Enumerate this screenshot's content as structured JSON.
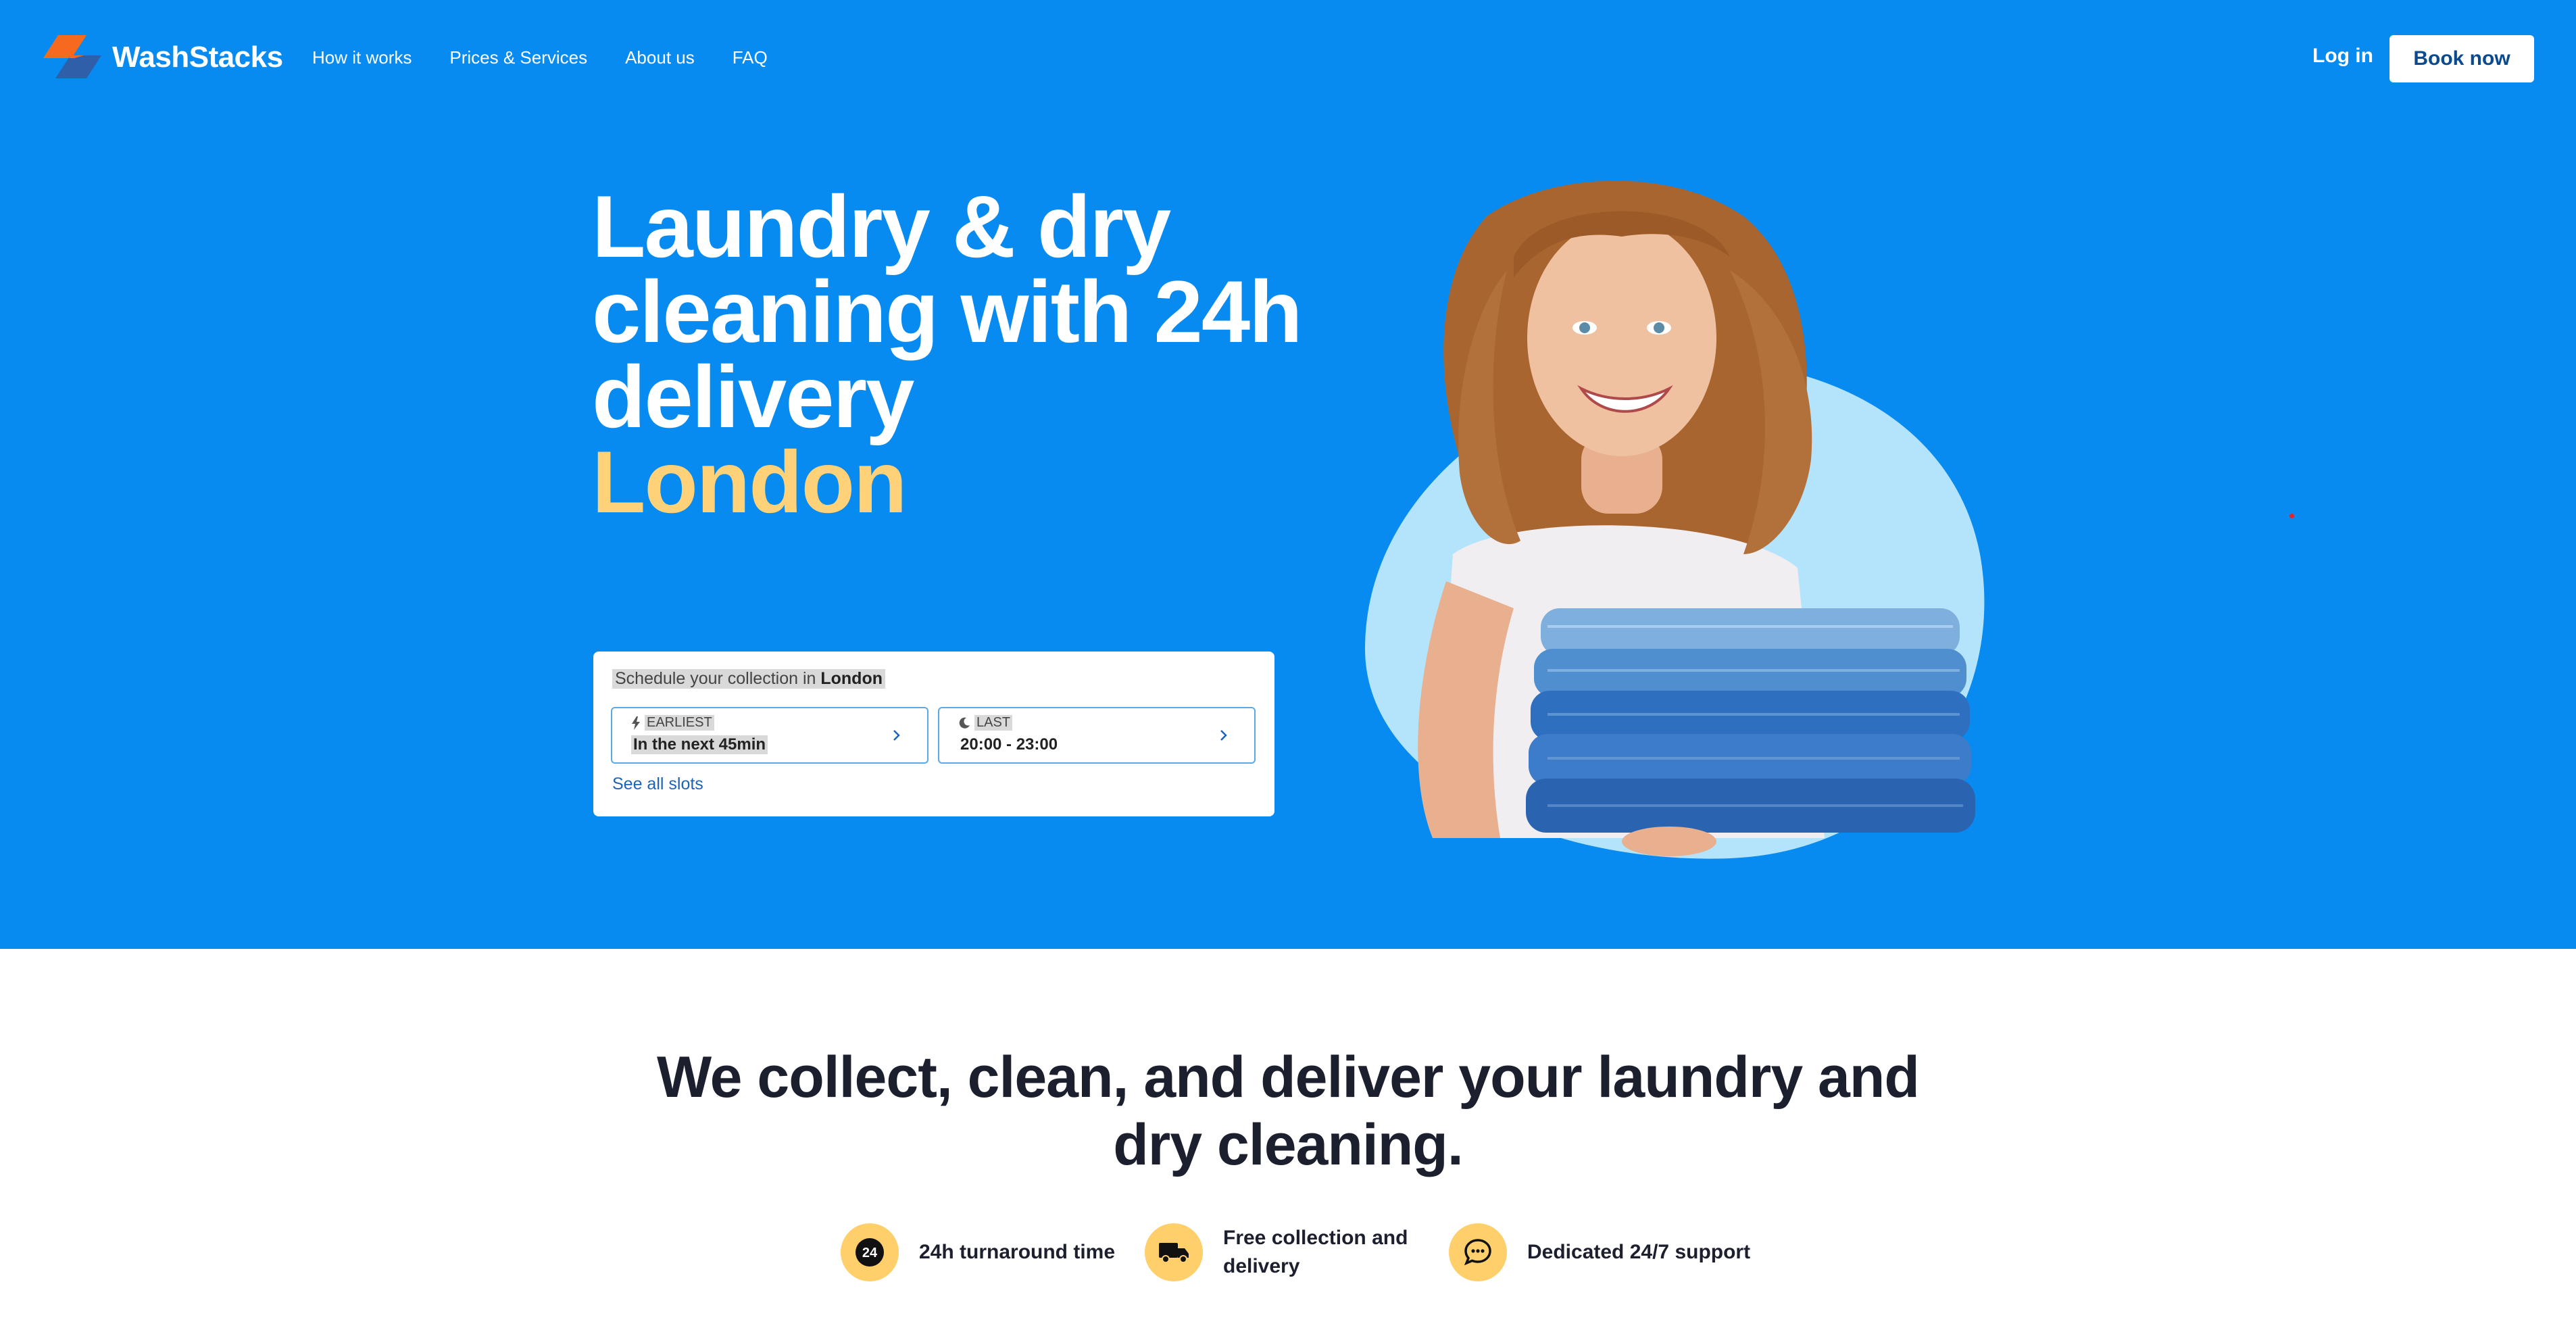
{
  "brand": {
    "name": "WashStacks",
    "colors": {
      "hero_bg": "#078bf0",
      "accent": "#ffd27a",
      "orange": "#f56a1f",
      "badge": "#ffcf6b"
    }
  },
  "nav": {
    "links": [
      "How it works",
      "Prices & Services",
      "About us",
      "FAQ"
    ],
    "login": "Log in",
    "book": "Book now"
  },
  "hero": {
    "headline": "Laundry & dry cleaning with 24h delivery",
    "city": "London"
  },
  "schedule": {
    "title_prefix": "Schedule your collection in ",
    "title_city": "London",
    "slots": [
      {
        "icon": "lightning-icon",
        "label": "EARLIEST",
        "value": "In the next 45min"
      },
      {
        "icon": "moon-icon",
        "label": "LAST",
        "value": "20:00 - 23:00"
      }
    ],
    "see_all": "See all slots"
  },
  "section": {
    "title": "We collect, clean, and deliver your laundry and dry cleaning."
  },
  "features": [
    {
      "icon": "24h-icon",
      "label": "24h turnaround time"
    },
    {
      "icon": "truck-icon",
      "label": "Free collection and delivery"
    },
    {
      "icon": "chat-icon",
      "label": "Dedicated 24/7 support"
    }
  ]
}
